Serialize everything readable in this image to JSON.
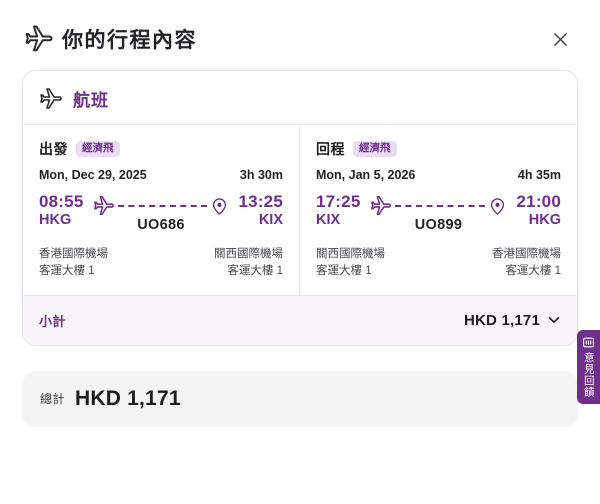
{
  "header": {
    "title": "你的行程內容"
  },
  "card": {
    "title": "航班",
    "segments": [
      {
        "direction_label": "出發",
        "cabin_badge": "經濟飛",
        "date": "Mon, Dec 29, 2025",
        "duration": "3h 30m",
        "dep_time": "08:55",
        "dep_code": "HKG",
        "arr_time": "13:25",
        "arr_code": "KIX",
        "flight_no": "UO686",
        "dep_airport": "香港國際機場",
        "dep_terminal": "客運大樓 1",
        "arr_airport": "關西國際機場",
        "arr_terminal": "客運大樓 1"
      },
      {
        "direction_label": "回程",
        "cabin_badge": "經濟飛",
        "date": "Mon, Jan 5, 2026",
        "duration": "4h 35m",
        "dep_time": "17:25",
        "dep_code": "KIX",
        "arr_time": "21:00",
        "arr_code": "HKG",
        "flight_no": "UO899",
        "dep_airport": "關西國際機場",
        "dep_terminal": "客運大樓 1",
        "arr_airport": "香港國際機場",
        "arr_terminal": "客運大樓 1"
      }
    ],
    "subtotal": {
      "label": "小計",
      "amount": "HKD 1,171"
    }
  },
  "total": {
    "label": "總計",
    "amount": "HKD 1,171"
  },
  "feedback_tab": {
    "label": "意見回饋"
  },
  "icons": {
    "airplane": "airplane-icon",
    "location_pin": "location-pin-icon",
    "close": "close-icon",
    "chevron_down": "chevron-down-icon",
    "survey": "survey-icon"
  },
  "colors": {
    "brand_purple": "#702f8a",
    "badge_bg": "#e9dcf4",
    "subtotal_bg": "#f8f6fc",
    "total_bg": "#f4f4f5",
    "card_border": "#e1e1e6",
    "text_dark": "#1c1c1e",
    "text_gray": "#47474d"
  }
}
